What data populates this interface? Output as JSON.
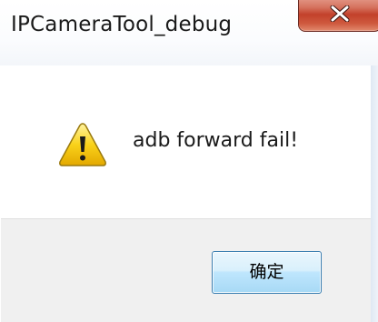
{
  "window": {
    "title": "IPCameraTool_debug"
  },
  "dialog": {
    "icon": "warning-icon",
    "message": "adb forward fail!",
    "ok_label": "确定"
  },
  "colors": {
    "close_button": "#c2412b",
    "warning_yellow": "#f6c400",
    "ok_button_border": "#3c7fb1",
    "footer_bg": "#f0f0f0"
  }
}
